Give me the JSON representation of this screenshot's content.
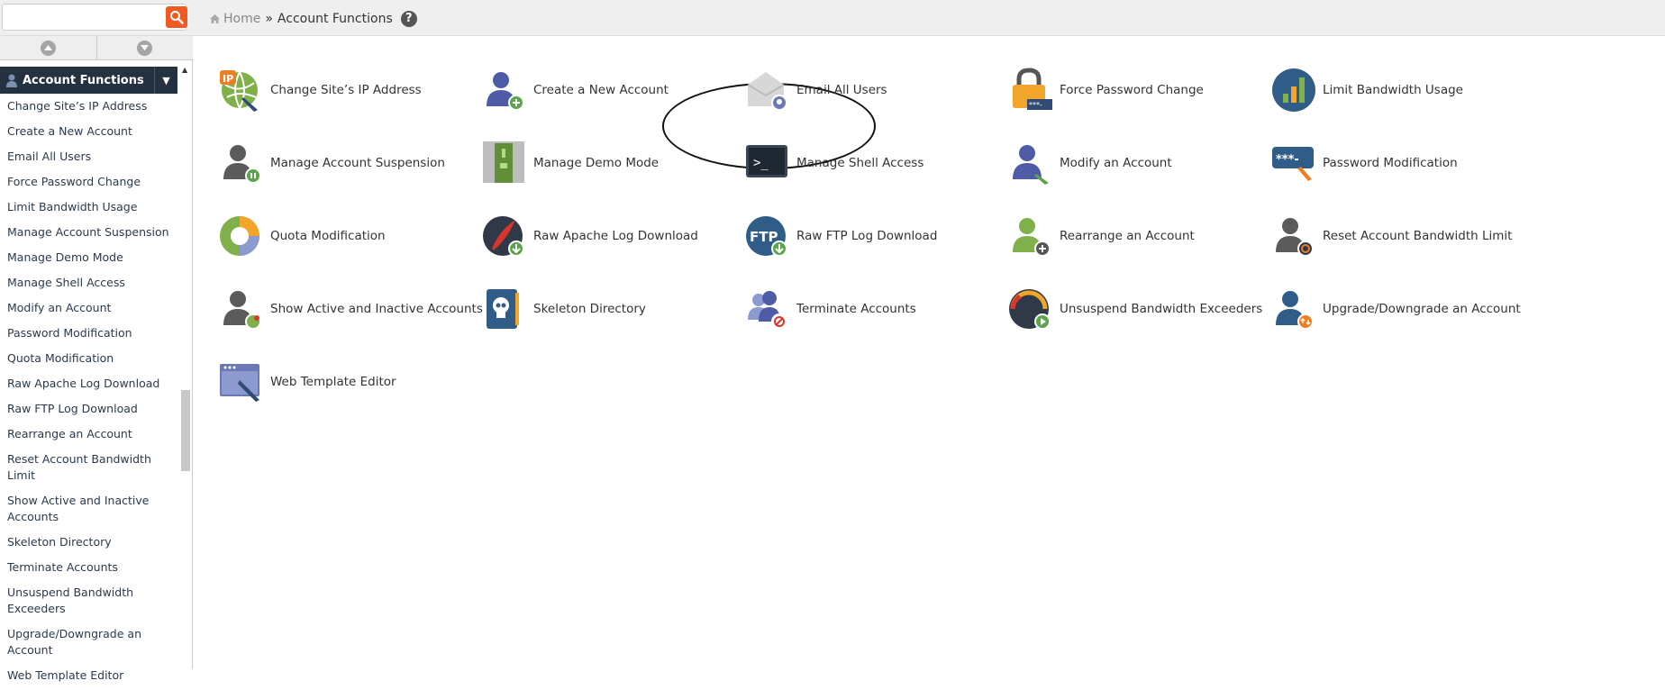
{
  "search": {
    "value": "",
    "placeholder": ""
  },
  "breadcrumb": {
    "home": "Home",
    "separator": "»",
    "current": "Account Functions",
    "help": "?"
  },
  "sidebar": {
    "section_title": "Account Functions",
    "items": [
      "Change Site’s IP Address",
      "Create a New Account",
      "Email All Users",
      "Force Password Change",
      "Limit Bandwidth Usage",
      "Manage Account Suspension",
      "Manage Demo Mode",
      "Manage Shell Access",
      "Modify an Account",
      "Password Modification",
      "Quota Modification",
      "Raw Apache Log Download",
      "Raw FTP Log Download",
      "Rearrange an Account",
      "Reset Account Bandwidth Limit",
      "Show Active and Inactive Accounts",
      "Skeleton Directory",
      "Terminate Accounts",
      "Unsuspend Bandwidth Exceeders",
      "Upgrade/Downgrade an Account",
      "Web Template Editor"
    ]
  },
  "tiles": [
    {
      "label": "Change Site’s IP Address",
      "icon": "ip-globe-icon"
    },
    {
      "label": "Create a New Account",
      "icon": "user-add-icon"
    },
    {
      "label": "Email All Users",
      "icon": "envelope-users-icon"
    },
    {
      "label": "Force Password Change",
      "icon": "padlock-icon"
    },
    {
      "label": "Limit Bandwidth Usage",
      "icon": "bar-graph-icon"
    },
    {
      "label": "Manage Account Suspension",
      "icon": "user-pause-icon"
    },
    {
      "label": "Manage Demo Mode",
      "icon": "demo-door-icon"
    },
    {
      "label": "Manage Shell Access",
      "icon": "terminal-icon"
    },
    {
      "label": "Modify an Account",
      "icon": "user-edit-icon"
    },
    {
      "label": "Password Modification",
      "icon": "password-edit-icon"
    },
    {
      "label": "Quota Modification",
      "icon": "pie-chart-icon"
    },
    {
      "label": "Raw Apache Log Download",
      "icon": "apache-feather-icon"
    },
    {
      "label": "Raw FTP Log Download",
      "icon": "ftp-download-icon"
    },
    {
      "label": "Rearrange an Account",
      "icon": "user-move-icon"
    },
    {
      "label": "Reset Account Bandwidth Limit",
      "icon": "user-reset-icon"
    },
    {
      "label": "Show Active and Inactive Accounts",
      "icon": "user-status-icon"
    },
    {
      "label": "Skeleton Directory",
      "icon": "skull-book-icon"
    },
    {
      "label": "Terminate Accounts",
      "icon": "users-terminate-icon"
    },
    {
      "label": "Unsuspend Bandwidth Exceeders",
      "icon": "gauge-play-icon"
    },
    {
      "label": "Upgrade/Downgrade an Account",
      "icon": "user-updown-icon"
    },
    {
      "label": "Web Template Editor",
      "icon": "browser-window-edit-icon"
    }
  ],
  "colors": {
    "accent": "#f05a22",
    "nav_dark": "#24313f",
    "link": "#2a3a4b",
    "ellipse": "#111111"
  }
}
